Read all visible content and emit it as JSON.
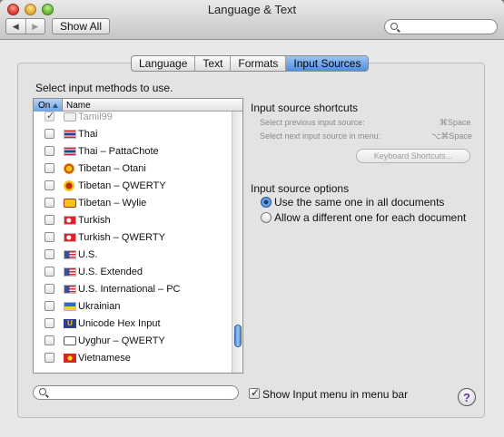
{
  "window": {
    "title": "Language & Text"
  },
  "toolbar": {
    "back_icon": "back-arrow",
    "forward_icon": "forward-arrow",
    "show_all_label": "Show All",
    "search_placeholder": ""
  },
  "tabs": [
    {
      "label": "Language",
      "active": false
    },
    {
      "label": "Text",
      "active": false
    },
    {
      "label": "Formats",
      "active": false
    },
    {
      "label": "Input Sources",
      "active": true
    }
  ],
  "list": {
    "instruction": "Select input methods to use.",
    "col_on": "On",
    "col_name": "Name",
    "items": [
      {
        "label": "Tamil99",
        "checked": true,
        "dimmed": true,
        "icon": "keyboard-icon"
      },
      {
        "label": "Thai",
        "checked": false,
        "icon": "thailand-flag"
      },
      {
        "label": "Thai – PattaChote",
        "checked": false,
        "icon": "thailand-flag"
      },
      {
        "label": "Tibetan – Otani",
        "checked": false,
        "icon": "tibetan-otani-icon"
      },
      {
        "label": "Tibetan – QWERTY",
        "checked": false,
        "icon": "tibetan-qwerty-icon"
      },
      {
        "label": "Tibetan – Wylie",
        "checked": false,
        "icon": "tibetan-wylie-icon"
      },
      {
        "label": "Turkish",
        "checked": false,
        "icon": "turkey-flag"
      },
      {
        "label": "Turkish – QWERTY",
        "checked": false,
        "icon": "turkey-flag"
      },
      {
        "label": "U.S.",
        "checked": false,
        "icon": "us-flag"
      },
      {
        "label": "U.S. Extended",
        "checked": false,
        "icon": "us-flag"
      },
      {
        "label": "U.S. International – PC",
        "checked": false,
        "icon": "us-flag"
      },
      {
        "label": "Ukrainian",
        "checked": false,
        "icon": "ukraine-flag"
      },
      {
        "label": "Unicode Hex Input",
        "checked": false,
        "icon": "unicode-icon"
      },
      {
        "label": "Uyghur – QWERTY",
        "checked": false,
        "icon": "uyghur-icon"
      },
      {
        "label": "Vietnamese",
        "checked": false,
        "icon": "vietnam-flag"
      }
    ]
  },
  "shortcuts": {
    "title": "Input source shortcuts",
    "prev_label": "Select previous input source:",
    "prev_key": "⌘Space",
    "next_label": "Select next input source in menu:",
    "next_key": "⌥⌘Space",
    "button_label": "Keyboard Shortcuts..."
  },
  "options": {
    "title": "Input source options",
    "radio_same": "Use the same one in all documents",
    "radio_different": "Allow a different one for each document",
    "selected": "same"
  },
  "bottom": {
    "search_placeholder": "",
    "show_menu_label": "Show Input menu in menu bar",
    "show_menu_checked": true,
    "help_label": "?"
  }
}
